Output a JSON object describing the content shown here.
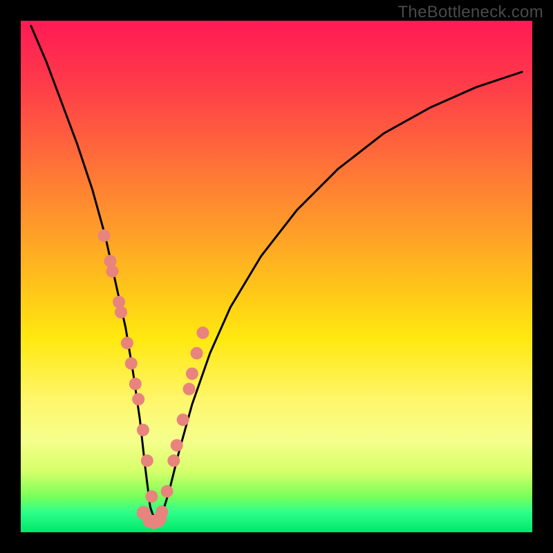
{
  "watermark": {
    "text": "TheBottleneck.com"
  },
  "chart_data": {
    "type": "line",
    "title": "",
    "xlabel": "",
    "ylabel": "",
    "xlim": [
      0,
      100
    ],
    "ylim": [
      0,
      100
    ],
    "series": [
      {
        "name": "bottleneck-curve",
        "x": [
          2,
          5,
          8,
          11,
          14,
          16.5,
          18.5,
          20.5,
          22,
          23.3,
          24.3,
          25.3,
          26.3,
          27.4,
          29,
          31,
          33.5,
          37,
          41,
          47,
          54,
          62,
          71,
          80,
          89,
          98
        ],
        "values": [
          99,
          92,
          84,
          76,
          67,
          58,
          49,
          40,
          31,
          22,
          13,
          5,
          2,
          2.8,
          8,
          16,
          25,
          35,
          44,
          54,
          63,
          71,
          78,
          83,
          87,
          90
        ]
      }
    ],
    "markers_left": {
      "name": "left-branch-dots",
      "x": [
        16.3,
        17.5,
        17.9,
        19.2,
        19.6,
        20.8,
        21.6,
        22.4,
        23.0,
        23.9,
        24.7,
        25.6
      ],
      "values": [
        58,
        53,
        51,
        45,
        43,
        37,
        33,
        29,
        26,
        20,
        14,
        7
      ]
    },
    "markers_right": {
      "name": "right-branch-dots",
      "x": [
        27.0,
        27.6,
        28.6,
        29.9,
        30.5,
        31.7,
        32.9,
        33.5,
        34.4,
        35.6
      ],
      "values": [
        2.5,
        4,
        8,
        14,
        17,
        22,
        28,
        31,
        35,
        39
      ]
    },
    "markers_bottom": {
      "name": "valley-dots",
      "x": [
        24.0,
        25.2,
        26.0,
        26.8,
        27.2
      ],
      "values": [
        3.8,
        2.2,
        2.0,
        2.2,
        2.8
      ]
    }
  }
}
